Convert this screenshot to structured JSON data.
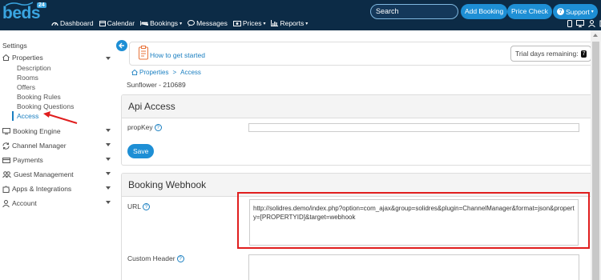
{
  "brand": {
    "name": "beds",
    "superscript": "24"
  },
  "nav": [
    {
      "label": "Dashboard",
      "icon": "dashboard-icon",
      "caret": false
    },
    {
      "label": "Calendar",
      "icon": "calendar-icon",
      "caret": false
    },
    {
      "label": "Bookings",
      "icon": "bed-icon",
      "caret": true
    },
    {
      "label": "Messages",
      "icon": "messages-icon",
      "caret": false
    },
    {
      "label": "Prices",
      "icon": "money-icon",
      "caret": true
    },
    {
      "label": "Reports",
      "icon": "chart-icon",
      "caret": true
    }
  ],
  "search": {
    "placeholder": "Search"
  },
  "top_buttons": {
    "add_booking": "Add Booking",
    "price_check": "Price Check",
    "support": "Support"
  },
  "sidebar": {
    "heading": "Settings",
    "properties": "Properties",
    "property_sub": [
      "Description",
      "Rooms",
      "Offers",
      "Booking Rules",
      "Booking Questions",
      "Access"
    ],
    "sections": [
      "Booking Engine",
      "Channel Manager",
      "Payments",
      "Guest Management",
      "Apps & Integrations",
      "Account"
    ]
  },
  "help": {
    "link": "How to get started",
    "trial_label": "Trial days remaining:",
    "trial_days": "7"
  },
  "breadcrumb": {
    "root": "Properties",
    "sep": ">",
    "current": "Access"
  },
  "property_name": "Sunflower - 210689",
  "api_access": {
    "title": "Api Access",
    "propkey_label": "propKey",
    "propkey_value": "",
    "save": "Save"
  },
  "webhook": {
    "title": "Booking Webhook",
    "url_label": "URL",
    "url_value": "http://solidres.demo/index.php?option=com_ajax&group=solidres&plugin=ChannelManager&format=json&property=[PROPERTYID]&target=webhook",
    "custom_header_label": "Custom Header"
  },
  "colors": {
    "topbar": "#0c2b46",
    "accent": "#1e8fd5",
    "highlight": "#e01e1e"
  }
}
